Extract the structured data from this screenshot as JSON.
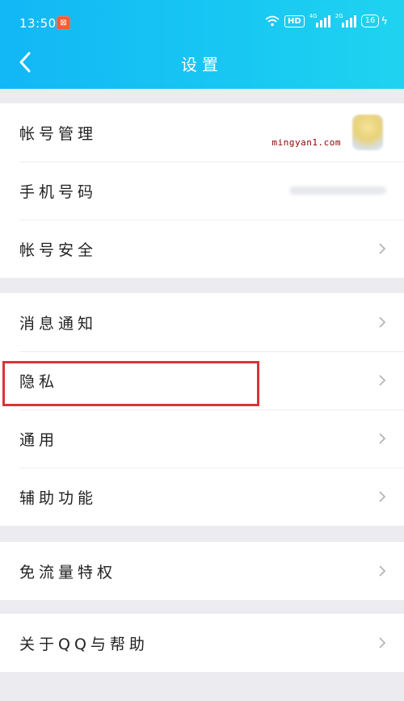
{
  "status_bar": {
    "time": "13:50",
    "app_icon": "toutiao-app-icon",
    "hd": "HD",
    "signal1_tag": "4G",
    "signal2_tag": "2G",
    "battery": "16"
  },
  "header": {
    "title": "设置",
    "background": "#12b7f5"
  },
  "groups": [
    {
      "items": [
        {
          "label": "帐号管理",
          "name": "account-management",
          "trailing": "avatar"
        },
        {
          "label": "手机号码",
          "name": "phone-number",
          "trailing": "masked"
        },
        {
          "label": "帐号安全",
          "name": "account-security",
          "trailing": "chevron"
        }
      ]
    },
    {
      "items": [
        {
          "label": "消息通知",
          "name": "message-notification",
          "trailing": "chevron"
        },
        {
          "label": "隐私",
          "name": "privacy",
          "trailing": "chevron"
        },
        {
          "label": "通用",
          "name": "general",
          "trailing": "chevron"
        },
        {
          "label": "辅助功能",
          "name": "accessibility",
          "trailing": "chevron"
        }
      ]
    },
    {
      "items": [
        {
          "label": "免流量特权",
          "name": "data-free-privilege",
          "trailing": "chevron"
        }
      ]
    },
    {
      "items": [
        {
          "label": "关于QQ与帮助",
          "name": "about-qq-help",
          "trailing": "chevron"
        }
      ]
    }
  ],
  "watermark": "mingyan1.com",
  "highlight_color": "#d9343a"
}
